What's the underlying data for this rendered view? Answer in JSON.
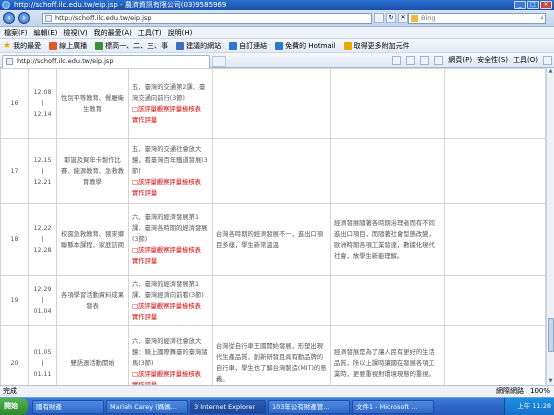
{
  "window": {
    "title": "http://schoff.ilc.edu.tw/eip.jsp - 農濟資訊有限公司(03)9585969"
  },
  "address": {
    "url": "http://schoff.ilc.edu.tw/eip.jsp",
    "search_placeholder": "Bing"
  },
  "menu": [
    "檔案(F)",
    "編輯(E)",
    "檢視(V)",
    "我的最愛(A)",
    "工具(T)",
    "說明(H)"
  ],
  "favorites": [
    {
      "label": "我的最愛",
      "color": "#e8a800"
    },
    {
      "label": "線上廣播",
      "color": "#e05a2a"
    },
    {
      "label": "標高一、二、三、事",
      "color": "#3b8f3b"
    },
    {
      "label": "建議的網站",
      "color": "#3c6fc4"
    },
    {
      "label": "自訂連結",
      "color": "#2a7bd0"
    },
    {
      "label": "免費的 Hotmail",
      "color": "#2a7bd0"
    },
    {
      "label": "取得更多附加元件",
      "color": "#e8a800"
    }
  ],
  "tab": {
    "label": "http://schoff.ilc.edu.tw/eip.jsp"
  },
  "commands": {
    "page": "網頁(P)",
    "safety": "安全性(S)",
    "tools": "工具(O)"
  },
  "rows": [
    {
      "week": "16",
      "date_top": "12.08",
      "date_bottom": "12.14",
      "activity": "性別平等教育、餐廳衛生教育",
      "unit": [
        {
          "t": "五、臺灣的交通第2課、臺灣交通向前行(3節)",
          "red": false
        },
        {
          "t": "□該評量觀察評量檢核表",
          "red": true
        },
        {
          "t": "實作評量",
          "red": true
        }
      ],
      "obj": [],
      "misc": []
    },
    {
      "week": "17",
      "date_top": "12.15",
      "date_bottom": "12.21",
      "activity": "耶誕及賀年卡製作比賽、能源教育、急救教育教學",
      "unit": [
        {
          "t": "五、臺灣的交通社會放大鏡，看臺灣百年鐵道發展(3節)",
          "red": false
        },
        {
          "t": "□該評量觀察評量檢核表",
          "red": true
        },
        {
          "t": "實作評量",
          "red": true
        }
      ],
      "obj": [],
      "misc": []
    },
    {
      "week": "18",
      "date_top": "12.22",
      "date_bottom": "12.28",
      "activity": "校園急救教育、猥來鄉聯縣本課程、家庭訪問",
      "unit": [
        {
          "t": "六、臺灣的經濟發展第1課、臺灣各時期的經濟發展(3節)",
          "red": false
        },
        {
          "t": "□該評量觀察評量檢核表",
          "red": true
        },
        {
          "t": "實作評量",
          "red": true
        }
      ],
      "obj": "台灣各時期的經濟發展不一，進出口項目多樣，學生新常溫溫",
      "misc": "經濟發展隨著各時期治理者而有不同進出口項目，而隨著社會型態改變，歐洲時期各項工業發達，數據化現代社會，故學生新能理解。"
    },
    {
      "week": "19",
      "date_top": "12.29",
      "date_bottom": "01.04",
      "activity": "各項學習活動資料成果發表",
      "unit": [
        {
          "t": "六、臺灣的經濟發展第1課、臺灣經濟向前看(3節)",
          "red": false
        },
        {
          "t": "□該評量觀察評量檢核表",
          "red": true
        },
        {
          "t": "實作評量",
          "red": true
        }
      ],
      "obj": [],
      "misc": []
    },
    {
      "week": "20",
      "date_top": "01.05",
      "date_bottom": "01.11",
      "activity": "雙語週活動開始",
      "unit": [
        {
          "t": "六、臺灣的經濟社會放大鏡：騎上國際舞臺的臺灣諸馬(3節)",
          "red": false
        },
        {
          "t": "□該評量觀察評量檢核表",
          "red": true
        },
        {
          "t": "實作評量",
          "red": true
        }
      ],
      "obj": "台灣從自行車王國開始發展，形塑出現代生產品質，創新研發且具有動品牌的自行車，學生也了解台灣製造(MIT)的意義。",
      "misc": "經濟發展是為了讓人民有更好的生活品質，所以上課時讓國在發展各項工業時，更要重視對環境現態的重視。"
    },
    {
      "week": "",
      "date_top": "",
      "date_bottom": "",
      "activity": "",
      "unit": [
        {
          "t": "六、臺灣的經濟社會放大",
          "red": false
        }
      ],
      "obj": [],
      "misc": []
    }
  ],
  "status": {
    "left": "完成",
    "zone": "網際網路",
    "zoom": "100%"
  },
  "taskbar": {
    "start": "開始",
    "tasks": [
      "國有財產",
      "Mariah Carey (媽媽...",
      "3 Internet Explorer",
      "103年公有財產管...",
      "文件1 - Microsoft ..."
    ],
    "clock": "上午 11:28"
  }
}
